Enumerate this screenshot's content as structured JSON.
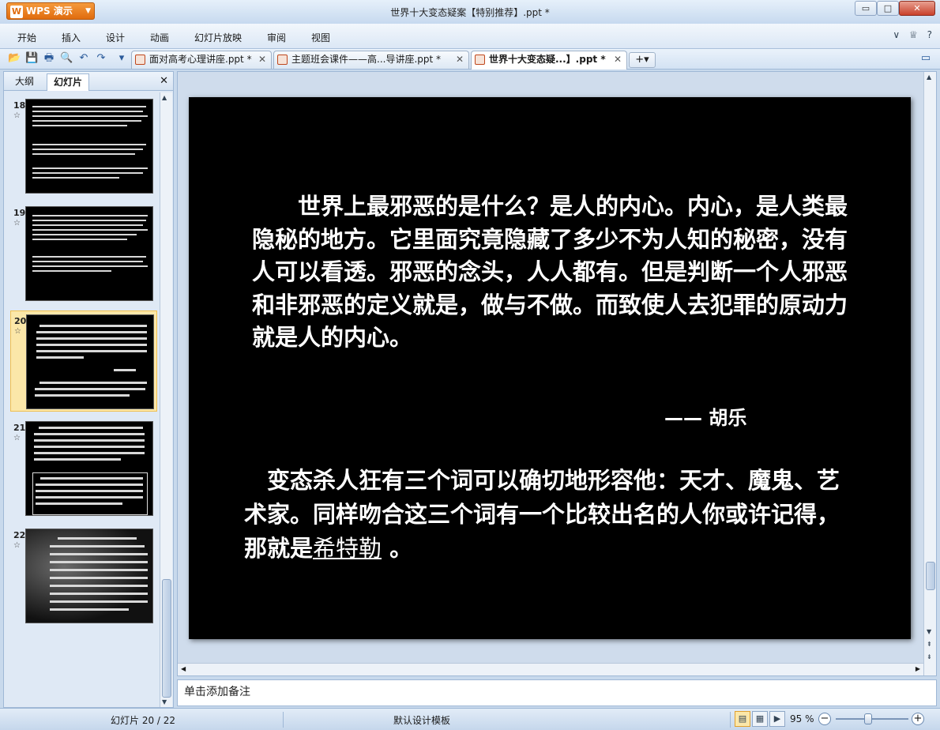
{
  "app": {
    "name": "WPS 演示",
    "logo": "W",
    "window_title": "世界十大变态疑案【特别推荐】.ppt *"
  },
  "window_controls": {
    "minimize": "▭",
    "maximize": "□",
    "close": "✕"
  },
  "menu": {
    "items": [
      "开始",
      "插入",
      "设计",
      "动画",
      "幻灯片放映",
      "审阅",
      "视图"
    ],
    "right_icons": [
      "∨",
      "♕",
      "?"
    ]
  },
  "toolbar": {
    "icons": [
      "open-icon",
      "save-icon",
      "print-icon",
      "print-preview-icon",
      "undo-icon",
      "redo-icon",
      "more-icon"
    ],
    "glyphs": [
      "📂",
      "💾",
      "🖶",
      "🔍",
      "↶",
      "↷",
      "▾"
    ]
  },
  "doc_tabs": [
    {
      "label": "面对高考心理讲座.ppt *",
      "close": "✕",
      "active": false
    },
    {
      "label": "主题班会课件——高...导讲座.ppt *",
      "close": "✕",
      "active": false
    },
    {
      "label": "世界十大变态疑...】.ppt *",
      "close": "✕",
      "active": true
    }
  ],
  "new_tab": {
    "label": "+▾"
  },
  "panel": {
    "tabs": [
      "大纲",
      "幻灯片"
    ],
    "active_tab": "幻灯片",
    "close": "✕",
    "scroll_up": "▲",
    "scroll_down": "▼"
  },
  "thumbnails": [
    {
      "num": "18",
      "star": "☆",
      "selected": false
    },
    {
      "num": "19",
      "star": "☆",
      "selected": false
    },
    {
      "num": "20",
      "star": "☆",
      "selected": true
    },
    {
      "num": "21",
      "star": "☆",
      "selected": false
    },
    {
      "num": "22",
      "star": "☆",
      "selected": false
    }
  ],
  "slide": {
    "paragraph1": "　　世界上最邪恶的是什么？是人的内心。内心，是人类最隐秘的地方。它里面究竟隐藏了多少不为人知的秘密，没有人可以看透。邪恶的念头，人人都有。但是判断一个人邪恶和非邪恶的定义就是，做与不做。而致使人去犯罪的原动力就是人的内心。",
    "attribution": "—— 胡乐",
    "paragraph2_pre": "　变态杀人狂有三个词可以确切地形容他：天才、魔鬼、艺术家。同样吻合这三个词有一个比较出名的人你或许记得，那就是",
    "paragraph2_highlight": "希特勒",
    "paragraph2_post": " 。"
  },
  "scroll": {
    "up": "▲",
    "down": "▼",
    "left": "◀",
    "right": "▶",
    "page_up": "⇞",
    "page_down": "⇟"
  },
  "notes": {
    "placeholder": "单击添加备注"
  },
  "status": {
    "slide_info": "幻灯片 20 / 22",
    "template": "默认设计模板",
    "view_glyphs": [
      "▤",
      "▦",
      "▶"
    ],
    "zoom": "95 %",
    "zoom_level": 95,
    "zoom_out": "−",
    "zoom_in": "+"
  }
}
